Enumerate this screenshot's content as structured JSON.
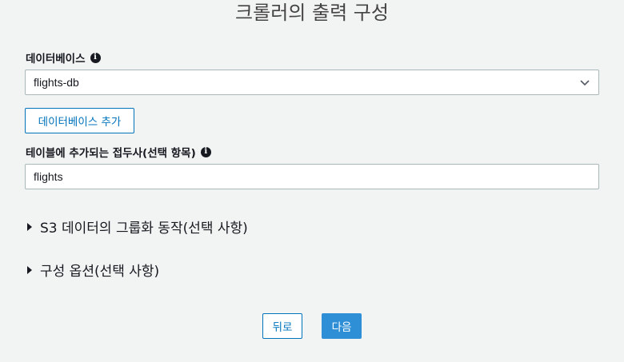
{
  "page": {
    "title": "크롤러의 출력 구성"
  },
  "database": {
    "label": "데이터베이스",
    "selected": "flights-db",
    "add_button": "데이터베이스 추가",
    "info_icon": "info-icon"
  },
  "prefix": {
    "label": "테이블에 추가되는 접두사(선택 항목)",
    "value": "flights",
    "info_icon": "info-icon"
  },
  "sections": {
    "s3_grouping": "S3 데이터의 그룹화 동작(선택 사항)",
    "config_options": "구성 옵션(선택 사항)"
  },
  "footer": {
    "back_label": "뒤로",
    "next_label": "다음"
  },
  "colors": {
    "accent": "#0073bb",
    "primary_button": "#2e8fd6",
    "background": "#f2f3f3"
  }
}
